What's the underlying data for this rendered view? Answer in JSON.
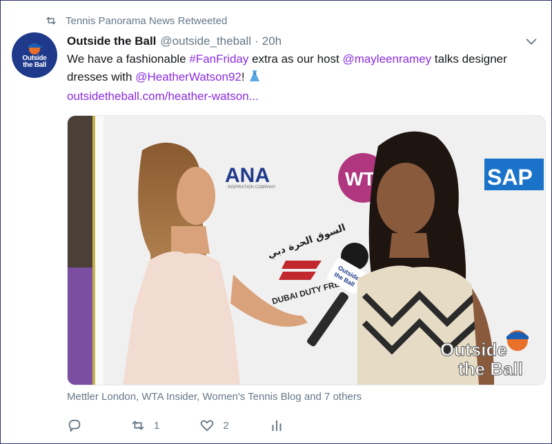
{
  "retweet": {
    "icon": "retweet-icon",
    "text": "Tennis Panorama News Retweeted"
  },
  "tweet": {
    "avatar_text_1": "Outside",
    "avatar_text_2": "the Ball",
    "name": "Outside the Ball",
    "handle": "@outside_theball",
    "separator": "·",
    "time": "20h",
    "text_parts": {
      "p1": "We have a fashionable ",
      "hashtag": "#FanFriday",
      "p2": " extra as our host ",
      "mention1": "@mayleenramey",
      "p3": " talks designer dresses with ",
      "mention2": "@HeatherWatson92",
      "p4": "! "
    },
    "url": "outsidetheball.com/heather-watson..."
  },
  "media": {
    "sponsors": {
      "ana": "ANA",
      "ana_sub": "INSPIRATION COMPANY",
      "wta": "WTA",
      "sap": "SAP",
      "dubai": "DUBAI DUTY FREE",
      "dubai_arabic": "السوق الحرة دبي"
    },
    "mic_label_1": "Outside",
    "mic_label_2": "the Ball",
    "watermark_1": "Outside",
    "watermark_2": "the Ball"
  },
  "stats": {
    "text": "Mettler London, WTA Insider, Women's Tennis Blog and 7 others"
  },
  "actions": {
    "replies": "",
    "retweets": "1",
    "likes": "2"
  },
  "colors": {
    "link": "#8a2be2",
    "muted": "#657786",
    "avatar_bg": "#1f3a8a",
    "ball": "#e8702a"
  }
}
